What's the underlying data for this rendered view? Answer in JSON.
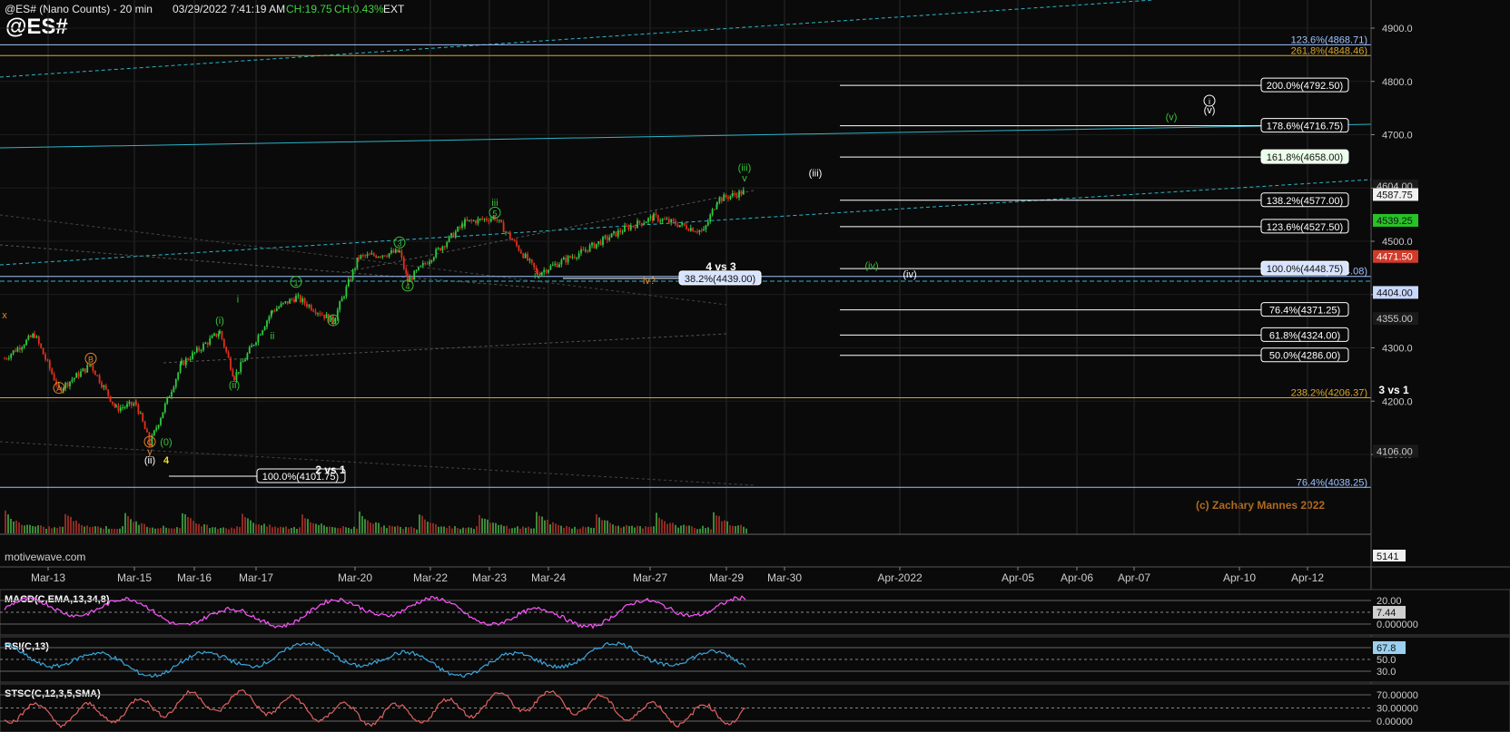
{
  "header": {
    "symbol": "@ES# (Nano Counts) - 20 min",
    "datetime": "03/29/2022 7:41:19 AM",
    "change_points": "CH:19.75",
    "change_pct": "CH:0.43%",
    "session": "EXT",
    "big_symbol": "@ES#"
  },
  "watermark": "motivewave.com",
  "copyright": "(c) Zachary Mannes 2022",
  "colors": {
    "background": "#0a0a0a",
    "grid": "#2a2a2a",
    "up_candle": "#2ecc40",
    "down_candle": "#e0301e",
    "fib_white": "#ffffff",
    "fib_orange": "#d7a52c",
    "fib_lightblue": "#9ec3ff",
    "channel_cyan": "#2bb5c9",
    "wave_green": "#38c238",
    "wave_orange": "#e0862a",
    "macd": "#ff55ff",
    "rsi": "#3aa6dd",
    "stoch": "#e06060"
  },
  "chart_data": {
    "type": "candlestick",
    "title": "@ES#",
    "timeframe": "20 min",
    "x_tick_labels": [
      "Mar-13",
      "Mar-15",
      "Mar-16",
      "Mar-17",
      "Mar-20",
      "Mar-22",
      "Mar-23",
      "Mar-24",
      "Mar-27",
      "Mar-29",
      "Mar-30",
      "Apr-2022",
      "Apr-05",
      "Apr-06",
      "Apr-07",
      "Apr-10",
      "Apr-12"
    ],
    "y_axis_labels": [
      4900,
      4800,
      4700,
      4600,
      4500,
      4400,
      4300,
      4200,
      4100
    ],
    "ylim": [
      4020,
      4940
    ],
    "price_path": [
      {
        "t": "Mar-13",
        "p": 4280
      },
      {
        "t": "Mar-13b",
        "p": 4325
      },
      {
        "t": "Mar-14",
        "p": 4222
      },
      {
        "t": "Mar-14b",
        "p": 4268
      },
      {
        "t": "Mar-15",
        "p": 4186
      },
      {
        "t": "Mar-15b",
        "p": 4195
      },
      {
        "t": "Mar-15c",
        "p": 4120
      },
      {
        "t": "Mar-16",
        "p": 4270
      },
      {
        "t": "Mar-16b",
        "p": 4330
      },
      {
        "t": "Mar-16c",
        "p": 4245
      },
      {
        "t": "Mar-17",
        "p": 4370
      },
      {
        "t": "Mar-17b",
        "p": 4395
      },
      {
        "t": "Mar-17c",
        "p": 4350
      },
      {
        "t": "Mar-20",
        "p": 4470
      },
      {
        "t": "Mar-21",
        "p": 4480
      },
      {
        "t": "Mar-21b",
        "p": 4425
      },
      {
        "t": "Mar-22",
        "p": 4535
      },
      {
        "t": "Mar-23",
        "p": 4545
      },
      {
        "t": "Mar-24",
        "p": 4440
      },
      {
        "t": "Mar-24b",
        "p": 4480
      },
      {
        "t": "Mar-26",
        "p": 4525
      },
      {
        "t": "Mar-27",
        "p": 4545
      },
      {
        "t": "Mar-28",
        "p": 4518
      },
      {
        "t": "Mar-28b",
        "p": 4578
      },
      {
        "t": "Mar-29",
        "p": 4593
      }
    ],
    "price_labels": [
      {
        "value": 4604.0,
        "text": "4604.00",
        "style": "gray"
      },
      {
        "value": 4587.75,
        "text": "4587.75",
        "style": "white"
      },
      {
        "value": 4539.25,
        "text": "4539.25",
        "style": "green"
      },
      {
        "value": 4471.5,
        "text": "4471.50",
        "style": "red"
      },
      {
        "value": 4404.0,
        "text": "4404.00",
        "style": "blue"
      },
      {
        "value": 4355.0,
        "text": "4355.00",
        "style": "gray"
      },
      {
        "value": 4106.0,
        "text": "4106.00",
        "style": "gray"
      }
    ],
    "fib_targets_right": [
      {
        "label": "200.0%(4792.50)",
        "value": 4792.5,
        "boxed": true,
        "fill": "none"
      },
      {
        "label": "178.6%(4716.75)",
        "value": 4716.75,
        "boxed": true,
        "fill": "none"
      },
      {
        "label": "161.8%(4658.00)",
        "value": 4658.0,
        "boxed": true,
        "fill": "#e9ffe9"
      },
      {
        "label": "138.2%(4577.00)",
        "value": 4577.0,
        "boxed": true,
        "fill": "none"
      },
      {
        "label": "123.6%(4527.50)",
        "value": 4527.5,
        "boxed": true,
        "fill": "none"
      },
      {
        "label": "100.0%(4448.75)",
        "value": 4448.75,
        "boxed": true,
        "fill": "#d8e4ff"
      },
      {
        "label": "76.4%(4371.25)",
        "value": 4371.25,
        "boxed": true,
        "fill": "none"
      },
      {
        "label": "61.8%(4324.00)",
        "value": 4324.0,
        "boxed": true,
        "fill": "none"
      },
      {
        "label": "50.0%(4286.00)",
        "value": 4286.0,
        "boxed": true,
        "fill": "none"
      }
    ],
    "fib_long_lines": [
      {
        "label": "123.6%(4868.71)",
        "value": 4868.71,
        "color": "#9ec3ff"
      },
      {
        "label": "261.8%(4848.46)",
        "value": 4848.46,
        "color": "#d7a52c"
      },
      {
        "label": "100.0%(4434.08)",
        "value": 4434.08,
        "color": "#9ec3ff"
      },
      {
        "label": "238.2%(4206.37)",
        "value": 4206.37,
        "color": "#d7a52c"
      },
      {
        "label": "76.4%(4038.25)",
        "value": 4038.25,
        "color": "#9ec3ff"
      }
    ],
    "other_fib_boxes": [
      {
        "label": "100.0%(4101.75)",
        "value": 4101.75
      },
      {
        "label": "38.2%(4439.00)",
        "value": 4439.0
      }
    ],
    "wave_labels": [
      {
        "text": "x",
        "color": "orange",
        "p": 4355,
        "t": "Mar-13"
      },
      {
        "text": "A",
        "color": "orange",
        "circle": true,
        "p": 4218,
        "t": "Mar-14"
      },
      {
        "text": "B",
        "color": "orange",
        "circle": true,
        "p": 4273,
        "t": "Mar-14b"
      },
      {
        "text": "C",
        "color": "orange",
        "circle": true,
        "p": 4117,
        "t": "Mar-15c"
      },
      {
        "text": "y",
        "color": "orange",
        "p": 4099,
        "t": "Mar-15c"
      },
      {
        "text": "(0)",
        "color": "green",
        "p": 4117,
        "t": "Mar-15c"
      },
      {
        "text": "(ii)",
        "color": "white",
        "p": 4083,
        "t": "Mar-15c"
      },
      {
        "text": "4",
        "color": "yellow",
        "p": 4083,
        "t": "Mar-15c"
      },
      {
        "text": "(i)",
        "color": "green",
        "p": 4345,
        "t": "Mar-16b"
      },
      {
        "text": "(ii)",
        "color": "green",
        "p": 4224,
        "t": "Mar-16c"
      },
      {
        "text": "i",
        "color": "green",
        "p": 4385,
        "t": "Mar-16c"
      },
      {
        "text": "ii",
        "color": "green",
        "p": 4316,
        "t": "Mar-17"
      },
      {
        "text": "1",
        "color": "green",
        "circle": true,
        "p": 4417,
        "t": "Mar-17b"
      },
      {
        "text": "2",
        "color": "green",
        "circle": true,
        "p": 4345,
        "t": "Mar-17c"
      },
      {
        "text": "3",
        "color": "green",
        "circle": true,
        "p": 4491,
        "t": "Mar-21"
      },
      {
        "text": "4",
        "color": "green",
        "circle": true,
        "p": 4410,
        "t": "Mar-21b"
      },
      {
        "text": "5",
        "color": "green",
        "circle": true,
        "p": 4547,
        "t": "Mar-23"
      },
      {
        "text": "iii",
        "color": "green",
        "p": 4566,
        "t": "Mar-23"
      },
      {
        "text": "iv",
        "color": "green",
        "p": 4430,
        "t": "Mar-24"
      },
      {
        "text": "iv?",
        "color": "orange",
        "p": 4420,
        "t": "Mar-27"
      },
      {
        "text": "(iii)",
        "color": "green",
        "p": 4632,
        "t": "Mar-29"
      },
      {
        "text": "v",
        "color": "green",
        "p": 4612,
        "t": "Mar-29"
      },
      {
        "text": "(iii)",
        "color": "white",
        "p": 4622,
        "t": "Mar-30"
      },
      {
        "text": "(iv)",
        "color": "green",
        "p": 4448,
        "t": "Apr-2022"
      },
      {
        "text": "(iv)",
        "color": "white",
        "p": 4432,
        "t": "Apr-2022"
      },
      {
        "text": "(v)",
        "color": "green",
        "p": 4727,
        "t": "Apr-07"
      },
      {
        "text": "(v)",
        "color": "white",
        "p": 4740,
        "t": "Apr-10"
      },
      {
        "text": "i",
        "color": "white",
        "circle": true,
        "p": 4757,
        "t": "Apr-10"
      }
    ],
    "annotations": [
      "2 vs 1",
      "4 vs 3",
      "3 vs 1"
    ],
    "volume_label": "5141",
    "indicators": [
      {
        "name": "MACD(C,EMA,13,34,8)",
        "scale_labels": [
          "20.00",
          "7.44",
          "0.000000"
        ]
      },
      {
        "name": "RSI(C,13)",
        "scale_labels": [
          "67.8",
          "50.0",
          "30.0"
        ]
      },
      {
        "name": "STSC(C,12,3,5,SMA)",
        "scale_labels": [
          "70.00000",
          "30.00000",
          "0.00000"
        ]
      }
    ]
  }
}
